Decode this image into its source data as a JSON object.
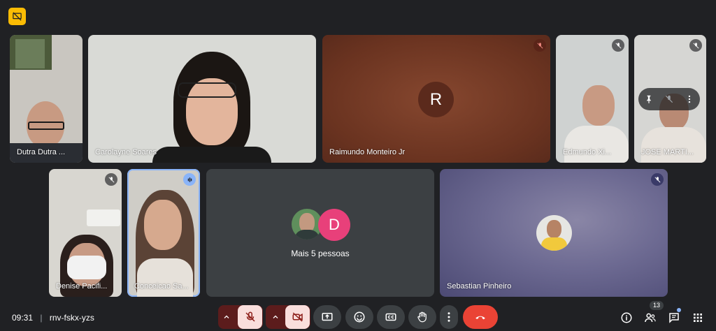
{
  "meeting": {
    "time": "09:31",
    "separator": "|",
    "code": "rnv-fskx-yzs"
  },
  "tiles": {
    "t1": {
      "name": "Dutra Dutra ..."
    },
    "t2": {
      "name": "Carolayne Soares"
    },
    "t3": {
      "name": "Raimundo Monteiro Jr",
      "initial": "R"
    },
    "t4": {
      "name": "Edmundo Xi..."
    },
    "t5": {
      "name": "JOSE MARTI..."
    },
    "t6": {
      "name": "Denise Pacifi..."
    },
    "t7": {
      "name": "Conceicao Sa..."
    },
    "t8": {
      "others_label": "Mais 5 pessoas",
      "avatar_initial": "D"
    },
    "t9": {
      "name": "Sebastian Pinheiro"
    }
  },
  "people_count": "13",
  "colors": {
    "background": "#202124",
    "accent": "#fbbc04",
    "end_call": "#ea4335",
    "avatar_d": "#e8407a",
    "speaking": "#8ab4f8"
  },
  "icons": [
    "presentation-icon",
    "mic-off-icon",
    "camera-off-icon",
    "present-screen-icon",
    "emoji-icon",
    "captions-icon",
    "raise-hand-icon",
    "more-options-icon",
    "end-call-icon",
    "info-icon",
    "people-icon",
    "chat-icon",
    "activities-icon",
    "pin-icon"
  ]
}
